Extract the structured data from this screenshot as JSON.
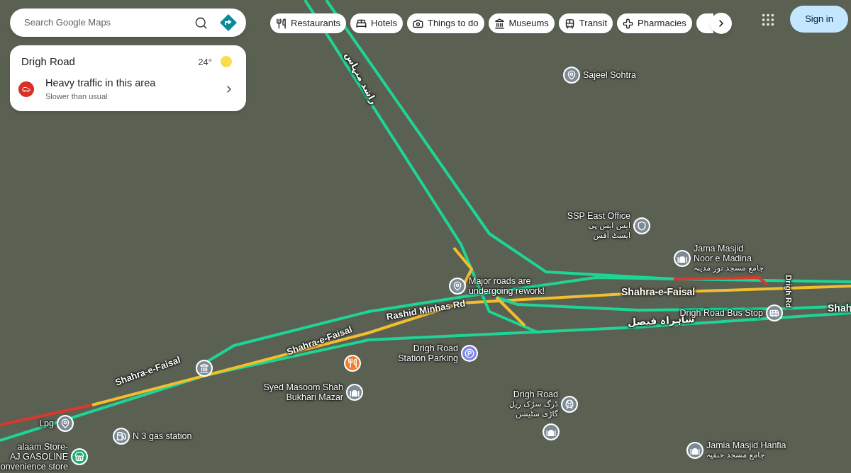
{
  "search": {
    "placeholder": "Search Google Maps"
  },
  "chips": [
    {
      "label": "Restaurants",
      "kind": "restaurant"
    },
    {
      "label": "Hotels",
      "kind": "hotel"
    },
    {
      "label": "Things to do",
      "kind": "camera"
    },
    {
      "label": "Museums",
      "kind": "museum"
    },
    {
      "label": "Transit",
      "kind": "transit"
    },
    {
      "label": "Pharmacies",
      "kind": "pharmacy"
    }
  ],
  "sign_in": "Sign in",
  "place_card": {
    "title": "Drigh Road",
    "temperature": "24°",
    "alert": {
      "title": "Heavy traffic in this area",
      "subtitle": "Slower than usual"
    }
  },
  "road_labels": [
    "راشد منہاس",
    "Shahra-e-Faisal",
    "Rashid Minhas Rd",
    "Shahra-e-Faisal",
    "Shahra-e-Faisal",
    "Drigh Rd",
    "Shah",
    "شاہراہ فیصل"
  ],
  "places": [
    {
      "kind": "pin",
      "color": "#7b8a94",
      "lines": [
        "Sajeel Sohtra"
      ]
    },
    {
      "kind": "police",
      "color": "#7b8a94",
      "lines": [
        "SSP East Office",
        "ایس ایس پی",
        "ایسٹ آفس"
      ]
    },
    {
      "kind": "mosque",
      "color": "#7b8a94",
      "lines": [
        "Jama Masjid",
        "Noor e Madina",
        "جامع مسجد نور مدینہ"
      ]
    },
    {
      "kind": "pin",
      "color": "#7b8a94",
      "lines": [
        "Major roads are",
        "undergoing rework!"
      ]
    },
    {
      "kind": "bus",
      "color": "#7b8a94",
      "lines": [
        "Drigh Road Bus Stop"
      ]
    },
    {
      "kind": "parking",
      "color": "#7b86e8",
      "lines": [
        "Drigh Road",
        "Station Parking"
      ]
    },
    {
      "kind": "restaurant",
      "color": "#f07b2c"
    },
    {
      "kind": "museum",
      "color": "#7b8a94"
    },
    {
      "kind": "mosque",
      "color": "#7b8a94",
      "lines": [
        "Syed Masoom Shah",
        "Bukhari Mazar"
      ]
    },
    {
      "kind": "train",
      "color": "#7b8a94",
      "lines": [
        "Drigh Road",
        "ڈرگ سڑک ریل",
        "گاڑی سٹیشن"
      ]
    },
    {
      "kind": "mosque",
      "color": "#7b8a94"
    },
    {
      "kind": "pin",
      "color": "#7b8a94",
      "lines": [
        "Lpg"
      ]
    },
    {
      "kind": "gas",
      "color": "#7b8a94",
      "lines": [
        "N 3 gas station"
      ]
    },
    {
      "kind": "store",
      "color": "#1fa971",
      "lines": [
        "alaam Store-",
        "AJ GASOLINE",
        "onvenience store"
      ]
    },
    {
      "kind": "mosque",
      "color": "#7b8a94",
      "lines": [
        "Jamia Masjid Hanfia",
        "جامع مسجد حنفیہ"
      ]
    }
  ]
}
